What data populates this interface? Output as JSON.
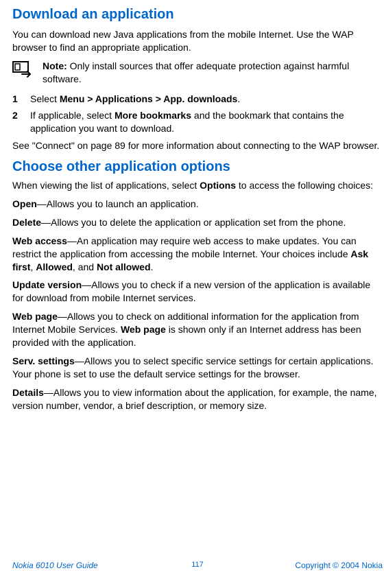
{
  "h1": "Download an application",
  "p_intro": "You can download new Java applications from the mobile Internet. Use the WAP browser to find an appropriate application.",
  "note_label": "Note:",
  "note_text": " Only install sources that offer adequate protection against harmful software.",
  "steps": [
    {
      "n": "1",
      "pre": "Select ",
      "bold": "Menu > Applications > App. downloads",
      "post": "."
    },
    {
      "n": "2",
      "pre": "If applicable, select ",
      "bold": "More bookmarks",
      "post": " and the bookmark that contains the application you want to download."
    }
  ],
  "p_see": "See \"Connect\" on page 89 for more information about connecting to the WAP browser.",
  "h2": "Choose other application options",
  "p_when_pre": "When viewing the list of applications, select ",
  "p_when_bold": "Options",
  "p_when_post": " to access the following choices:",
  "opt_open_b": "Open",
  "opt_open_t": "—Allows you to launch an application.",
  "opt_delete_b": "Delete",
  "opt_delete_t": "—Allows you to delete the application or application set from the phone.",
  "opt_web_b": "Web access",
  "opt_web_t1": "—An application may require web access to make updates. You can restrict the application from accessing the mobile Internet. Your choices include ",
  "opt_web_b2": "Ask first",
  "opt_web_sep1": ", ",
  "opt_web_b3": "Allowed",
  "opt_web_sep2": ", and ",
  "opt_web_b4": "Not allowed",
  "opt_web_end": ".",
  "opt_update_b": "Update version",
  "opt_update_t": "—Allows you to check if a new version of the application is available for download from mobile Internet services.",
  "opt_page_b": "Web page",
  "opt_page_t1": "—Allows you to check on additional information for the application from Internet Mobile Services. ",
  "opt_page_b2": "Web page",
  "opt_page_t2": " is shown only if an Internet address has been provided with the application.",
  "opt_serv_b": "Serv. settings",
  "opt_serv_t": "—Allows you to select specific service settings for certain applications. Your phone is set to use the default service settings for the browser.",
  "opt_details_b": "Details",
  "opt_details_t": "—Allows you to view information about the application, for example, the name, version number, vendor, a brief description, or memory size.",
  "footer_left": "Nokia 6010 User Guide",
  "footer_center": "117",
  "footer_right": "Copyright © 2004 Nokia"
}
